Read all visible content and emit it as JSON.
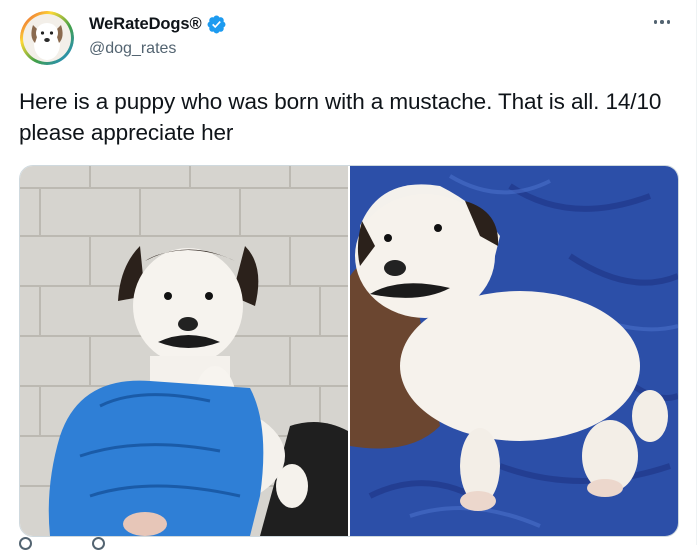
{
  "author": {
    "display_name": "WeRateDogs®",
    "handle": "@dog_rates",
    "verified": true,
    "verified_color": "#1d9bf0",
    "avatar_icon": "dog-avatar"
  },
  "tweet": {
    "text": "Here is a puppy who was born with a mustache. That is all. 14/10 please appreciate her"
  },
  "menu": {
    "icon": "more-icon"
  },
  "media": [
    {
      "name": "puppy-photo-held",
      "description_icon": "photo"
    },
    {
      "name": "puppy-photo-blanket",
      "description_icon": "photo"
    }
  ]
}
